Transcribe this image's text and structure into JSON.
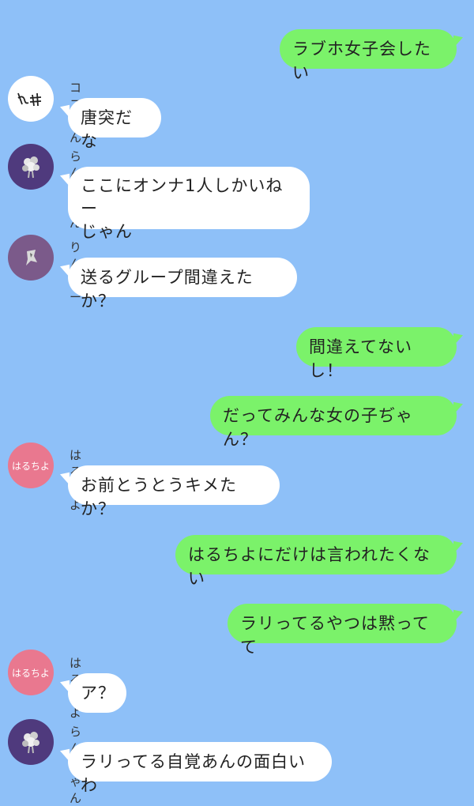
{
  "colors": {
    "background": "#8ec0f8",
    "outgoing_bubble": "#7bf26a",
    "incoming_bubble": "#ffffff"
  },
  "messages": [
    {
      "side": "out",
      "text": "ラブホ女子会したい"
    },
    {
      "side": "in",
      "sender": "ココくん",
      "avatar_icon": "handwritten-signature-avatar",
      "text": "唐突だな"
    },
    {
      "side": "in",
      "sender": "らんちゃん",
      "avatar_icon": "flower-bouquet-avatar",
      "text": "ここにオンナ1人しかいねー\nじゃん"
    },
    {
      "side": "in",
      "sender": "りんどー",
      "avatar_icon": "figure-avatar",
      "text": "送るグループ間違えたか？"
    },
    {
      "side": "out",
      "text": "間違えてないし！"
    },
    {
      "side": "out",
      "text": "だってみんな女の子ぢゃん？"
    },
    {
      "side": "in",
      "sender": "はるちよ",
      "avatar_icon": "pink-text-avatar",
      "avatar_text": "はるちよ",
      "text": "お前とうとうキメたか？"
    },
    {
      "side": "out",
      "text": "はるちよにだけは言われたくない"
    },
    {
      "side": "out",
      "text": "ラリってるやつは黙ってて"
    },
    {
      "side": "in",
      "sender": "はるちよ",
      "avatar_icon": "pink-text-avatar",
      "avatar_text": "はるちよ",
      "text": "ア？"
    },
    {
      "side": "in",
      "sender": "らんちゃん",
      "avatar_icon": "flower-bouquet-avatar",
      "text": "ラリってる自覚あんの面白いわ"
    }
  ]
}
